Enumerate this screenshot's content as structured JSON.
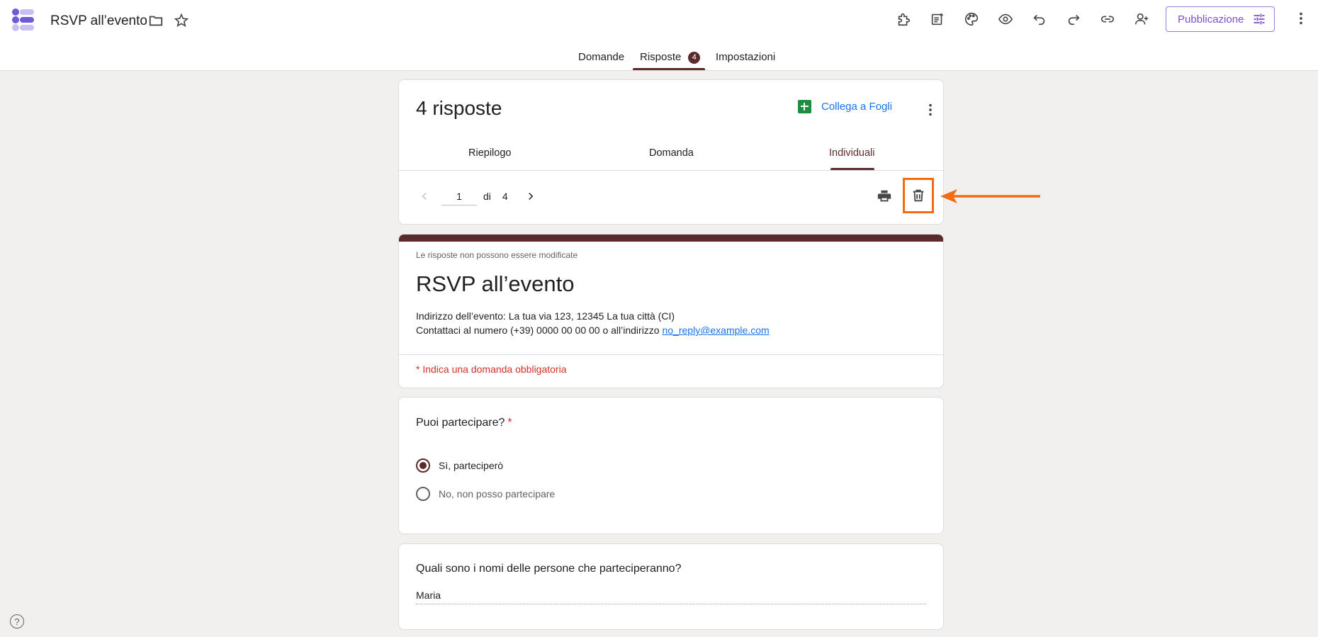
{
  "header": {
    "doc_title": "RSVP all’evento",
    "publish_label": "Pubblicazione"
  },
  "top_tabs": {
    "questions": "Domande",
    "responses": "Risposte",
    "responses_badge": "4",
    "settings": "Impostazioni"
  },
  "summary": {
    "count_label": "4 risposte",
    "sheets_link": "Collega a Fogli",
    "tabs": {
      "summary": "Riepilogo",
      "question": "Domanda",
      "individual": "Individuali"
    },
    "pager": {
      "current": "1",
      "of_label": "di",
      "total": "4"
    }
  },
  "form": {
    "no_edit_note": "Le risposte non possono essere modificate",
    "title": "RSVP all’evento",
    "address_line": "Indirizzo dell’evento: La tua via 123, 12345 La tua città (CI)",
    "contact_prefix": "Contattaci al numero (+39) 0000 00 00 00 o all’indirizzo ",
    "contact_email": "no_reply@example.com",
    "required_note": "* Indica una domanda obbligatoria"
  },
  "questions": [
    {
      "title": "Puoi partecipare?",
      "required_mark": "*",
      "options": [
        "Sì, parteciperò",
        "No, non posso partecipare"
      ],
      "selected": "Sì, parteciperò"
    },
    {
      "title": "Quali sono i nomi delle persone che parteciperanno?",
      "answer": "Maria"
    }
  ],
  "help_label": "?",
  "colors": {
    "theme": "#5b2b2b",
    "accent_link": "#1a73e8",
    "publish": "#7c4dcf",
    "highlight_box": "#f26c11",
    "required": "#d93025"
  },
  "icons": [
    "forms-logo-icon",
    "folder-icon",
    "star-icon",
    "addon-icon",
    "customize-icon",
    "palette-icon",
    "preview-icon",
    "undo-icon",
    "redo-icon",
    "link-icon",
    "add-collaborator-icon",
    "tune-icon",
    "more-vert-icon",
    "sheets-icon",
    "chevron-left-icon",
    "chevron-right-icon",
    "print-icon",
    "delete-icon",
    "arrow-annotation",
    "help-icon"
  ]
}
